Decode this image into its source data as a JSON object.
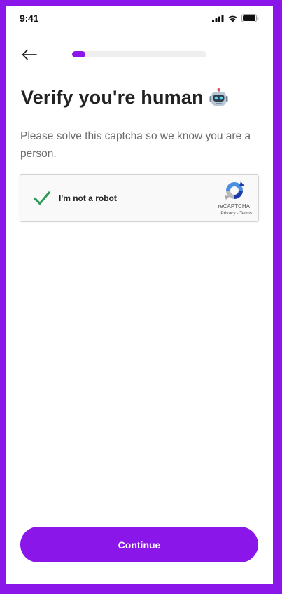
{
  "status_bar": {
    "time": "9:41",
    "icons": [
      "cellular-signal-icon",
      "wifi-icon",
      "battery-icon"
    ]
  },
  "header": {
    "back_icon": "arrow-left-icon",
    "progress_fraction": 0.1
  },
  "main": {
    "title": "Verify you're human",
    "title_emoji": "🤖",
    "subtitle": "Please solve this captcha so we know you are a person."
  },
  "captcha": {
    "label": "I'm not a robot",
    "checked": true,
    "brand": "reCAPTCHA",
    "privacy_link": "Privacy",
    "separator": " - ",
    "terms_link": "Terms"
  },
  "footer": {
    "continue_label": "Continue"
  },
  "colors": {
    "accent": "#8a16ea",
    "check_green": "#2e9a5a",
    "title_text": "#222222",
    "body_text": "#6b6b6b"
  }
}
